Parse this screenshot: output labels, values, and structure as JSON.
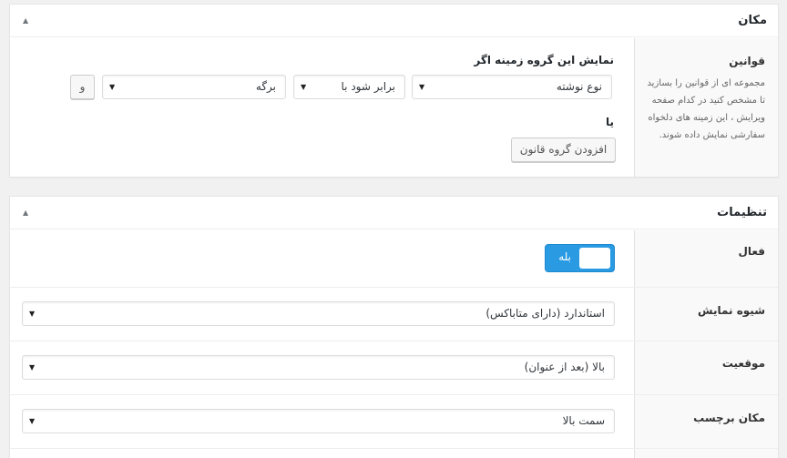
{
  "location": {
    "title": "مکان",
    "rules_label": "قوانین",
    "rules_description": "مجموعه ای از قوانین را بسازید تا مشخص کنید در کدام صفحه ویرایش ، این زمینه های دلخواه سفارشی نمایش داده شوند.",
    "show_if": "نمایش این گروه زمینه اگر",
    "param_value": "نوع نوشته",
    "operator_value": "برابر شود با",
    "rule_value": "برگه",
    "and_button": "و",
    "or_label": "یا",
    "add_group_button": "افزودن گروه قانون"
  },
  "settings": {
    "title": "تنظیمات",
    "active_label": "فعال",
    "active_toggle": "بله",
    "style_label": "شیوه نمایش",
    "style_value": "استاندارد (دارای متاباکس)",
    "position_label": "موقعیت",
    "position_value": "بالا (بعد از عنوان)",
    "label_placement_label": "مکان برچسب",
    "label_placement_value": "سمت بالا"
  },
  "colors": {
    "accent": "#2a9be3",
    "background": "#f1f1f1",
    "panel": "#ffffff"
  }
}
